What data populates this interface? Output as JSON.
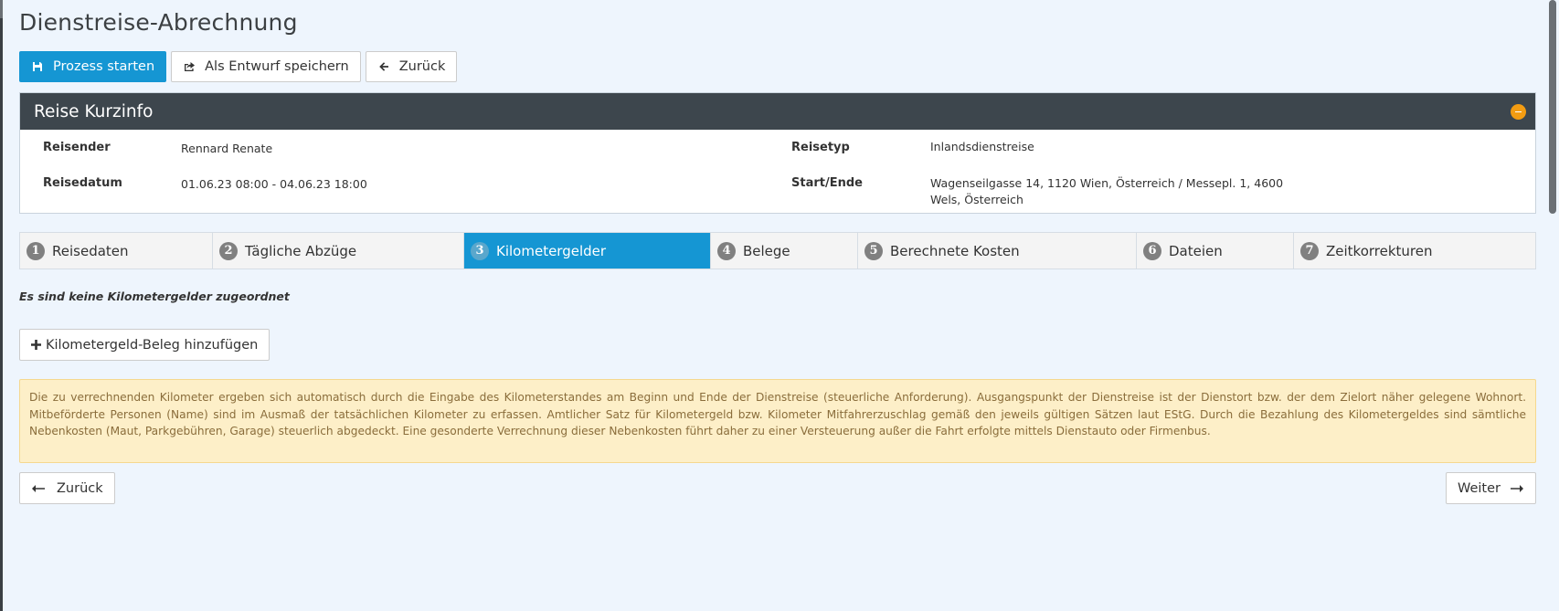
{
  "page": {
    "title": "Dienstreise-Abrechnung"
  },
  "toolbar": {
    "start_label": "Prozess starten",
    "draft_label": "Als Entwurf speichern",
    "back_label": "Zurück"
  },
  "panel": {
    "title": "Reise Kurzinfo",
    "fields": {
      "reisender_label": "Reisender",
      "reisender_value": "Rennard Renate",
      "reisedatum_label": "Reisedatum",
      "reisedatum_value": "01.06.23 08:00 - 04.06.23 18:00",
      "reisetyp_label": "Reisetyp",
      "reisetyp_value": "Inlandsdienstreise",
      "startende_label": "Start/Ende",
      "startende_value_line1": "Wagenseilgasse 14, 1120 Wien, Österreich / Messepl. 1, 4600",
      "startende_value_line2": "Wels, Österreich"
    }
  },
  "wizard": {
    "steps": [
      {
        "num": "1",
        "label": "Reisedaten"
      },
      {
        "num": "2",
        "label": "Tägliche Abzüge"
      },
      {
        "num": "3",
        "label": "Kilometergelder"
      },
      {
        "num": "4",
        "label": "Belege"
      },
      {
        "num": "5",
        "label": "Berechnete Kosten"
      },
      {
        "num": "6",
        "label": "Dateien"
      },
      {
        "num": "7",
        "label": "Zeitkorrekturen"
      }
    ],
    "active_step": "3"
  },
  "content": {
    "empty_message": "Es sind keine Kilometergelder zugeordnet",
    "add_button_label": "Kilometergeld-Beleg hinzufügen",
    "alert_text": "Die zu verrechnenden Kilometer ergeben sich automatisch durch die Eingabe des Kilometerstandes am Beginn und Ende der Dienstreise (steuerliche Anforderung). Ausgangspunkt der Dienstreise ist der Dienstort bzw. der dem Zielort näher gelegene Wohnort. Mitbeförderte Personen (Name) sind im Ausmaß der tatsächlichen Kilometer zu erfassen. Amtlicher Satz für Kilometergeld bzw. Kilometer Mitfahrerzuschlag gemäß den jeweils gültigen Sätzen laut EStG. Durch die Bezahlung des Kilometergeldes sind sämtliche Nebenkosten (Maut, Parkgebühren, Garage) steuerlich abgedeckt. Eine gesonderte Verrechnung dieser Nebenkosten führt daher zu einer Versteuerung außer die Fahrt erfolgte mittels Dienstauto oder Firmenbus."
  },
  "nav": {
    "back_label": "Zurück",
    "next_label": "Weiter"
  },
  "colors": {
    "primary": "#1596d3",
    "panel_header": "#3d464d",
    "collapse_badge": "#f39c12",
    "alert_bg": "#fdefc8",
    "alert_text": "#8a6d3b"
  },
  "icons": {
    "start": "save-icon",
    "draft": "share-icon",
    "back": "arrow-left-icon",
    "add": "plus-icon",
    "nav_back": "long-arrow-left-icon",
    "nav_next": "long-arrow-right-icon",
    "collapse": "minus-circle-icon"
  }
}
